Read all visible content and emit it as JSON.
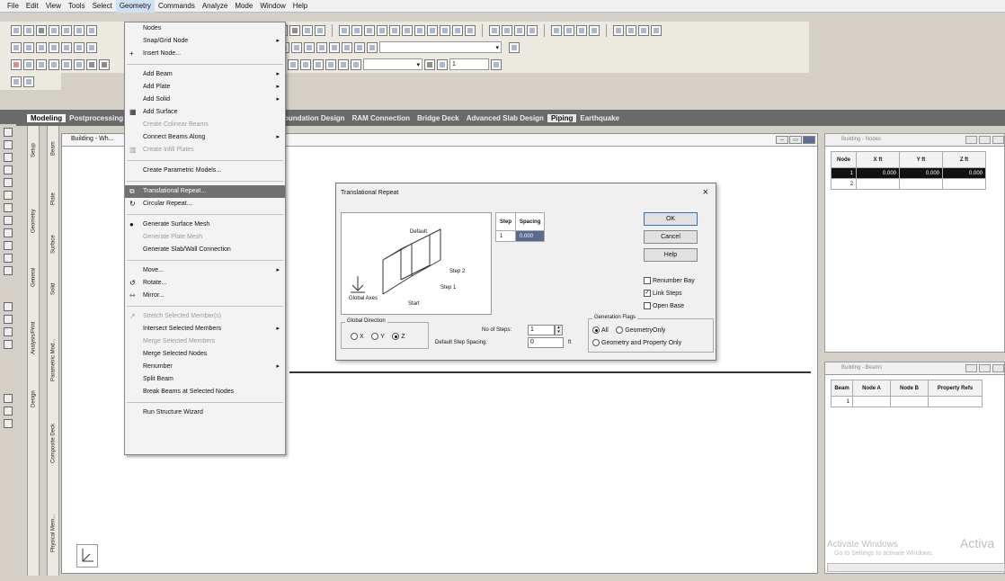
{
  "menubar": [
    "File",
    "Edit",
    "View",
    "Tools",
    "Select",
    "Geometry",
    "Commands",
    "Analyze",
    "Mode",
    "Window",
    "Help"
  ],
  "tabs": [
    "Modeling",
    "Postprocessing",
    "Foundation Design",
    "RAM Connection",
    "Bridge Deck",
    "Advanced Slab Design",
    "Piping",
    "Earthquake"
  ],
  "toolbar": {
    "step_value": "1"
  },
  "vtabs": [
    "Setup",
    "Geometry",
    "General",
    "Analysis/Print",
    "Design",
    "Beam",
    "Plate",
    "Surface",
    "Solid",
    "Parametric Mod...",
    "Composite Deck",
    "Physical Mem..."
  ],
  "menu": {
    "items": [
      {
        "label": "Nodes",
        "icon": "",
        "disabled": false,
        "arrow": false
      },
      {
        "label": "Snap/Grid Node",
        "icon": "",
        "disabled": false,
        "arrow": true
      },
      {
        "label": "Insert Node...",
        "icon": "+",
        "disabled": false,
        "arrow": false
      },
      "sep",
      {
        "label": "Add Beam",
        "icon": "",
        "disabled": false,
        "arrow": true
      },
      {
        "label": "Add Plate",
        "icon": "",
        "disabled": false,
        "arrow": true
      },
      {
        "label": "Add Solid",
        "icon": "",
        "disabled": false,
        "arrow": true
      },
      {
        "label": "Add Surface",
        "icon": "▦",
        "disabled": false,
        "arrow": false
      },
      {
        "label": "Create Colinear Beams",
        "icon": "",
        "disabled": true,
        "arrow": false
      },
      {
        "label": "Connect Beams Along",
        "icon": "",
        "disabled": false,
        "arrow": true
      },
      {
        "label": "Create Infill Plates",
        "icon": "▥",
        "disabled": true,
        "arrow": false
      },
      "sep",
      {
        "label": "Create Parametric Models...",
        "icon": "",
        "disabled": false,
        "arrow": false
      },
      "sep",
      {
        "label": "Translational Repeat...",
        "icon": "⧉",
        "disabled": false,
        "arrow": false,
        "highlight": true
      },
      {
        "label": "Circular Repeat...",
        "icon": "↻",
        "disabled": false,
        "arrow": false
      },
      "sep",
      {
        "label": "Generate Surface Mesh",
        "icon": "●",
        "disabled": false,
        "arrow": false
      },
      {
        "label": "Generate Plate Mesh",
        "icon": "",
        "disabled": true,
        "arrow": false
      },
      {
        "label": "Generate Slab/Wall Connection",
        "icon": "",
        "disabled": false,
        "arrow": false
      },
      "sep",
      {
        "label": "Move...",
        "icon": "",
        "disabled": false,
        "arrow": true
      },
      {
        "label": "Rotate...",
        "icon": "↺",
        "disabled": false,
        "arrow": false
      },
      {
        "label": "Mirror...",
        "icon": "⇿",
        "disabled": false,
        "arrow": false
      },
      "sep",
      {
        "label": "Stretch Selected Member(s)",
        "icon": "↗",
        "disabled": true,
        "arrow": false
      },
      {
        "label": "Intersect Selected Members",
        "icon": "",
        "disabled": false,
        "arrow": true
      },
      {
        "label": "Merge Selected Members",
        "icon": "",
        "disabled": true,
        "arrow": false
      },
      {
        "label": "Merge Selected Nodes",
        "icon": "",
        "disabled": false,
        "arrow": false
      },
      {
        "label": "Renumber",
        "icon": "",
        "disabled": false,
        "arrow": true
      },
      {
        "label": "Split Beam",
        "icon": "",
        "disabled": false,
        "arrow": false
      },
      {
        "label": "Break Beams at Selected Nodes",
        "icon": "",
        "disabled": false,
        "arrow": false
      },
      "sep",
      {
        "label": "Run Structure Wizard",
        "icon": "",
        "disabled": false,
        "arrow": false
      }
    ]
  },
  "workspace": {
    "title": "Building - Wh..."
  },
  "dialog": {
    "title": "Translational Repeat",
    "close": "×",
    "preview_labels": {
      "default": "Default",
      "step2": "Step 2",
      "step1": "Step 1",
      "start": "Start",
      "global_axes": "Global Axes"
    },
    "step_table": {
      "headers": [
        "Step",
        "Spacing"
      ],
      "row": [
        "1",
        "0.000"
      ]
    },
    "buttons": {
      "ok": "OK",
      "cancel": "Cancel",
      "help": "Help"
    },
    "checkboxes": [
      {
        "label": "Renumber Bay",
        "checked": false
      },
      {
        "label": "Link Steps",
        "checked": true
      },
      {
        "label": "Open Base",
        "checked": false
      }
    ],
    "global_direction": {
      "legend": "Global Direction",
      "options": [
        {
          "label": "X",
          "checked": false
        },
        {
          "label": "Y",
          "checked": false
        },
        {
          "label": "Z",
          "checked": true
        }
      ]
    },
    "num_steps_label": "No of Steps:",
    "num_steps_value": "1",
    "default_spacing_label": "Default Step Spacing:",
    "default_spacing_value": "0",
    "unit": "ft",
    "gen_flags": {
      "legend": "Generation Flags",
      "options": [
        {
          "label": "All",
          "checked": true
        },
        {
          "label": "GeometryOnly",
          "checked": false
        },
        {
          "label": "Geometry and Property Only",
          "checked": false
        }
      ]
    }
  },
  "nodes_panel": {
    "title": "Building - Nodes",
    "headers": [
      "Node",
      "X ft",
      "Y ft",
      "Z ft"
    ],
    "rows": [
      [
        "1",
        "0.000",
        "0.000",
        "0.000"
      ],
      [
        "2",
        "",
        "",
        ""
      ]
    ]
  },
  "beams_panel": {
    "title": "Building - Beams",
    "headers": [
      "Beam",
      "Node A",
      "Node B",
      "Property Refs"
    ],
    "rows": [
      [
        "1",
        "",
        "",
        ""
      ]
    ]
  },
  "watermark": {
    "big": "Activa",
    "line1": "Activate Windows",
    "line2": "Go to Settings to activate Windows."
  }
}
